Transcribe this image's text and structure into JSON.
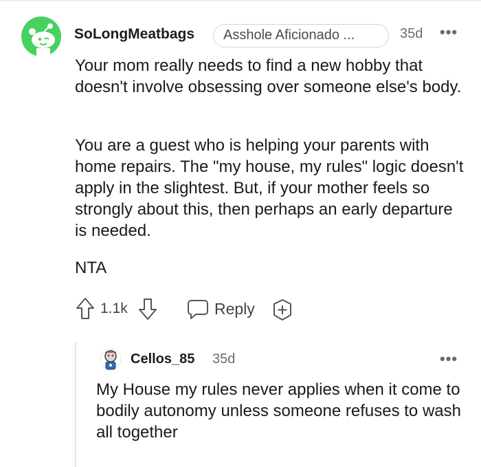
{
  "comment": {
    "username": "SoLongMeatbags",
    "flair": "Asshole Aficionado ...",
    "age": "35d",
    "more_icon": "more-options-icon",
    "paragraphs": [
      "Your mom really needs to find a new hobby that doesn't involve obsessing over someone else's body.",
      "You are a guest who is helping your parents with home repairs. The \"my house, my rules\" logic doesn't apply in the slightest. But, if your mother feels so strongly about this, then perhaps an early departure is needed.",
      "NTA"
    ],
    "vote_count": "1.1k",
    "reply_label": "Reply",
    "colors": {
      "avatar_green": "#46d160",
      "meta_gray": "#6b6b6b"
    }
  },
  "reply": {
    "username": "Cellos_85",
    "age": "35d",
    "text": "My House my rules never applies when it come to bodily autonomy unless someone refuses to wash all together"
  }
}
